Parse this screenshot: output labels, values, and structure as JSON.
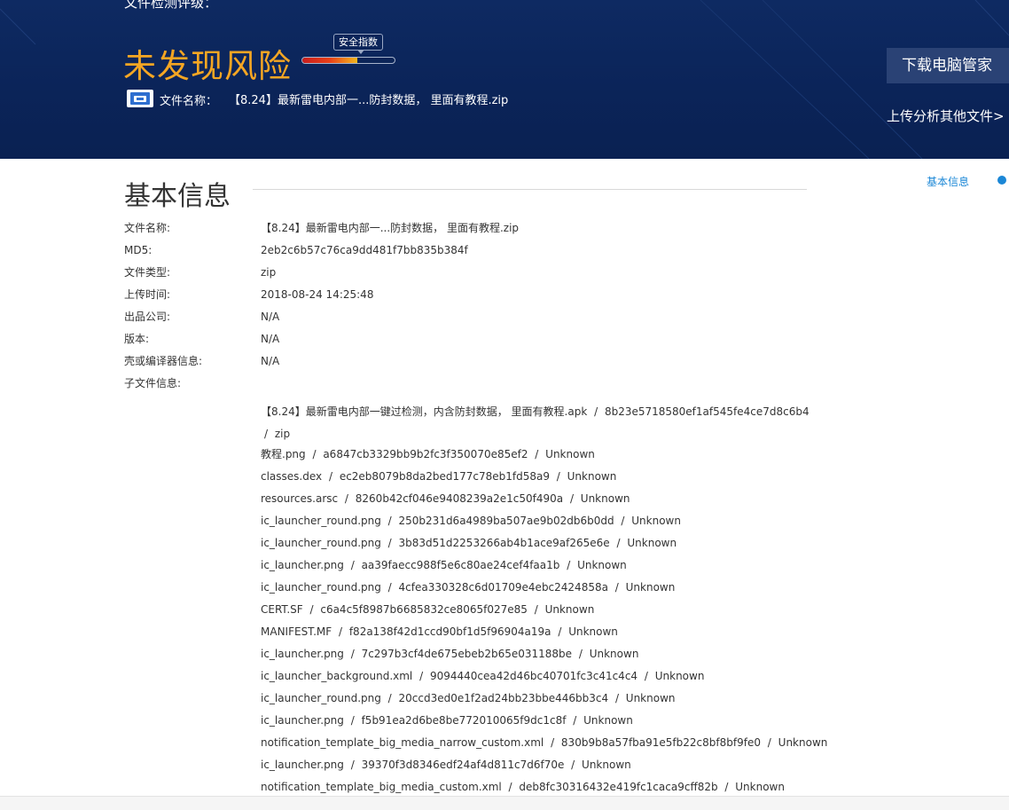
{
  "banner": {
    "title_cut": "文件检测评级：",
    "risk_result": "未发现风险",
    "index_tip": "安全指数",
    "index_fill": 0.6,
    "file_label": "文件名称：",
    "file_name": "【8.24】最新雷电内部一...防封数据， 里面有教程.zip",
    "download_button": "下载电脑管家",
    "upload_link": "上传分析其他文件>",
    "colors": {
      "risk": "#f5a623",
      "banner_bg": "#0b2459"
    }
  },
  "basic": {
    "title": "基本信息",
    "side_nav_label": "基本信息",
    "rows": [
      {
        "key": "文件名称:",
        "value": "【8.24】最新雷电内部一...防封数据， 里面有教程.zip"
      },
      {
        "key": "MD5:",
        "value": "2eb2c6b57c76ca9dd481f7bb835b384f"
      },
      {
        "key": "文件类型:",
        "value": "zip"
      },
      {
        "key": "上传时间:",
        "value": "2018-08-24 14:25:48"
      },
      {
        "key": "出品公司:",
        "value": "N/A"
      },
      {
        "key": "版本:",
        "value": "N/A"
      },
      {
        "key": "壳或编译器信息:",
        "value": "N/A"
      },
      {
        "key": "子文件信息:",
        "value": ""
      }
    ],
    "sub_files": [
      {
        "name": "【8.24】最新雷电内部一键过检测，内含防封数据， 里面有教程.apk",
        "md5": "8b23e5718580ef1af545fe4ce7d8c6b4",
        "type": "zip"
      },
      {
        "name": "教程.png",
        "md5": "a6847cb3329bb9b2fc3f350070e85ef2",
        "type": "Unknown"
      },
      {
        "name": "classes.dex",
        "md5": "ec2eb8079b8da2bed177c78eb1fd58a9",
        "type": "Unknown"
      },
      {
        "name": "resources.arsc",
        "md5": "8260b42cf046e9408239a2e1c50f490a",
        "type": "Unknown"
      },
      {
        "name": "ic_launcher_round.png",
        "md5": "250b231d6a4989ba507ae9b02db6b0dd",
        "type": "Unknown"
      },
      {
        "name": "ic_launcher_round.png",
        "md5": "3b83d51d2253266ab4b1ace9af265e6e",
        "type": "Unknown"
      },
      {
        "name": "ic_launcher.png",
        "md5": "aa39faecc988f5e6c80ae24cef4faa1b",
        "type": "Unknown"
      },
      {
        "name": "ic_launcher_round.png",
        "md5": "4cfea330328c6d01709e4ebc2424858a",
        "type": "Unknown"
      },
      {
        "name": "CERT.SF",
        "md5": "c6a4c5f8987b6685832ce8065f027e85",
        "type": "Unknown"
      },
      {
        "name": "MANIFEST.MF",
        "md5": "f82a138f42d1ccd90bf1d5f96904a19a",
        "type": "Unknown"
      },
      {
        "name": "ic_launcher.png",
        "md5": "7c297b3cf4de675ebeb2b65e031188be",
        "type": "Unknown"
      },
      {
        "name": "ic_launcher_background.xml",
        "md5": "9094440cea42d46bc40701fc3c41c4c4",
        "type": "Unknown"
      },
      {
        "name": "ic_launcher_round.png",
        "md5": "20ccd3ed0e1f2ad24bb23bbe446bb3c4",
        "type": "Unknown"
      },
      {
        "name": "ic_launcher.png",
        "md5": "f5b91ea2d6be8be772010065f9dc1c8f",
        "type": "Unknown"
      },
      {
        "name": "notification_template_big_media_narrow_custom.xml",
        "md5": "830b9b8a57fba91e5fb22c8bf8bf9fe0",
        "type": "Unknown"
      },
      {
        "name": "ic_launcher.png",
        "md5": "39370f3d8346edf24af4d811c7d6f70e",
        "type": "Unknown"
      },
      {
        "name": "notification_template_big_media_custom.xml",
        "md5": "deb8fc30316432e419fc1caca9cff82b",
        "type": "Unknown"
      }
    ]
  }
}
